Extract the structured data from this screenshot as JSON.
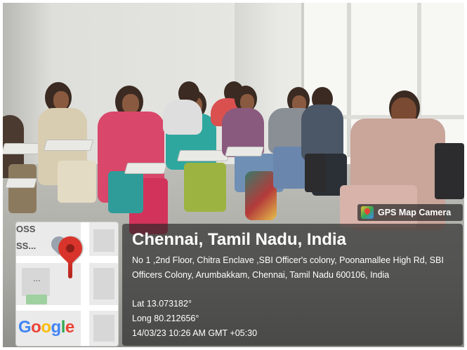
{
  "photo": {
    "description_icons": [
      "classroom-photo"
    ]
  },
  "badge": {
    "label": "GPS Map Camera",
    "icon": "gps-map-camera-icon"
  },
  "location": {
    "title": "Chennai, Tamil Nadu, India",
    "address": "No 1 ,2nd Floor, Chitra Enclave ,SBI Officer's colony, Poonamallee High Rd, SBI Officers Colony, Arumbakkam, Chennai, Tamil Nadu 600106, India",
    "lat": "Lat 13.073182°",
    "long": "Long 80.212656°",
    "datetime": "14/03/23 10:26 AM GMT +05:30"
  },
  "map": {
    "label_top": "OSS",
    "label_mid": "SS...",
    "label_dots": "...",
    "google": [
      "G",
      "o",
      "o",
      "g",
      "l",
      "e"
    ],
    "pin_icon": "location-pin-icon",
    "pin_color": "#d9342b"
  }
}
